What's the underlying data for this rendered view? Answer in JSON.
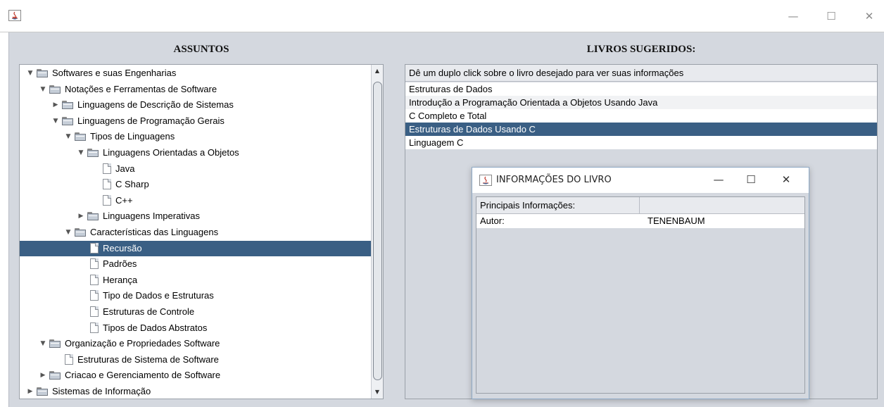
{
  "window": {
    "buttons": {
      "minimize": "—",
      "maximize": "☐",
      "close": "✕"
    }
  },
  "left": {
    "title": "ASSUNTOS",
    "tree": [
      {
        "label": "Softwares e suas Engenharias",
        "type": "folder",
        "toggle": "▼",
        "depth": 0
      },
      {
        "label": "Notações e Ferramentas de Software",
        "type": "folder",
        "toggle": "▼",
        "depth": 1
      },
      {
        "label": "Linguagens de Descrição de Sistemas",
        "type": "folder",
        "toggle": "▶",
        "depth": 2
      },
      {
        "label": "Linguagens de Programação Gerais",
        "type": "folder",
        "toggle": "▼",
        "depth": 2
      },
      {
        "label": "Tipos de Linguagens",
        "type": "folder",
        "toggle": "▼",
        "depth": 3
      },
      {
        "label": "Linguagens Orientadas a Objetos",
        "type": "folder",
        "toggle": "▼",
        "depth": 4
      },
      {
        "label": "Java",
        "type": "leaf",
        "depth": 5
      },
      {
        "label": "C Sharp",
        "type": "leaf",
        "depth": 5
      },
      {
        "label": "C++",
        "type": "leaf",
        "depth": 5
      },
      {
        "label": "Linguagens Imperativas",
        "type": "folder",
        "toggle": "▶",
        "depth": 4
      },
      {
        "label": "Características das Linguagens",
        "type": "folder",
        "toggle": "▼",
        "depth": 3
      },
      {
        "label": "Recursão",
        "type": "leaf",
        "depth": 4,
        "selected": true
      },
      {
        "label": "Padrões",
        "type": "leaf",
        "depth": 4
      },
      {
        "label": "Herança",
        "type": "leaf",
        "depth": 4
      },
      {
        "label": "Tipo de Dados e Estruturas",
        "type": "leaf",
        "depth": 4
      },
      {
        "label": "Estruturas de Controle",
        "type": "leaf",
        "depth": 4
      },
      {
        "label": "Tipos de Dados Abstratos",
        "type": "leaf",
        "depth": 4
      },
      {
        "label": "Organização e Propriedades Software",
        "type": "folder",
        "toggle": "▼",
        "depth": 1
      },
      {
        "label": "Estruturas de Sistema de Software",
        "type": "leaf",
        "depth": 2
      },
      {
        "label": "Criacao e Gerenciamento de Software",
        "type": "folder",
        "toggle": "▶",
        "depth": 1
      },
      {
        "label": "Sistemas de Informação",
        "type": "folder",
        "toggle": "▶",
        "depth": 0
      }
    ]
  },
  "right": {
    "title": "LIVROS SUGERIDOS:",
    "header": "Dê um duplo click sobre o livro desejado para ver suas informações",
    "books": [
      {
        "label": "Estruturas de Dados"
      },
      {
        "label": "Introdução a Programação Orientada a Objetos Usando Java"
      },
      {
        "label": "C Completo e Total"
      },
      {
        "label": "Estruturas de Dados Usando C",
        "selected": true
      },
      {
        "label": "Linguagem C"
      }
    ]
  },
  "dialog": {
    "title": "INFORMAÇÕES DO LIVRO",
    "buttons": {
      "minimize": "—",
      "maximize": "☐",
      "close": "✕"
    },
    "columns": [
      "Principais Informações:",
      ""
    ],
    "rows": [
      {
        "key": "Autor:",
        "value": "TENENBAUM"
      }
    ]
  }
}
